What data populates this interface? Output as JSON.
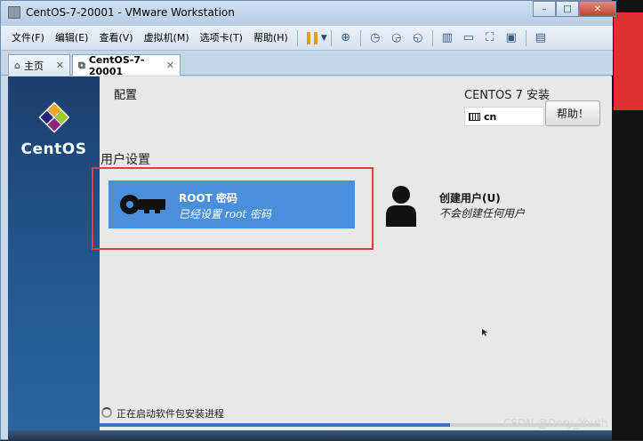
{
  "window": {
    "title": "CentOS-7-20001 - VMware Workstation",
    "controls": {
      "minimize": "–",
      "maximize": "□",
      "close": "✕"
    }
  },
  "menubar": {
    "items": [
      {
        "label": "文件(F)"
      },
      {
        "label": "编辑(E)"
      },
      {
        "label": "查看(V)"
      },
      {
        "label": "虚拟机(M)"
      },
      {
        "label": "选项卡(T)"
      },
      {
        "label": "帮助(H)"
      }
    ]
  },
  "toolbar": {
    "icons": [
      "pause-icon",
      "network-icon",
      "snapshot-icon",
      "snapshot-revert-icon",
      "snapshot-manager-icon",
      "sidebar-view-icon",
      "console-view-icon",
      "fit-window-icon",
      "fullscreen-icon",
      "unity-icon"
    ]
  },
  "tabs": [
    {
      "label": "主页",
      "close": "✕"
    },
    {
      "label": "CentOS-7-20001",
      "close": "✕"
    }
  ],
  "guest": {
    "brand": "CentOS",
    "config_heading": "配置",
    "install_title": "CENTOS 7 安装",
    "keyboard_layout": "cn",
    "help_label": "帮助！",
    "section_heading": "用户设置",
    "root_spoke": {
      "title": "ROOT 密码",
      "status": "已经设置 root 密码"
    },
    "user_spoke": {
      "title": "创建用户(U)",
      "status": "不会创建任何用户"
    },
    "progress_status": "正在启动软件包安装进程",
    "progress_fraction": 0.7
  },
  "watermark": "CSDN @Dory_Youth",
  "colors": {
    "tile_selected": "#4a8fdc",
    "highlight": "#e53c3c",
    "sidebar": "#245a94"
  }
}
